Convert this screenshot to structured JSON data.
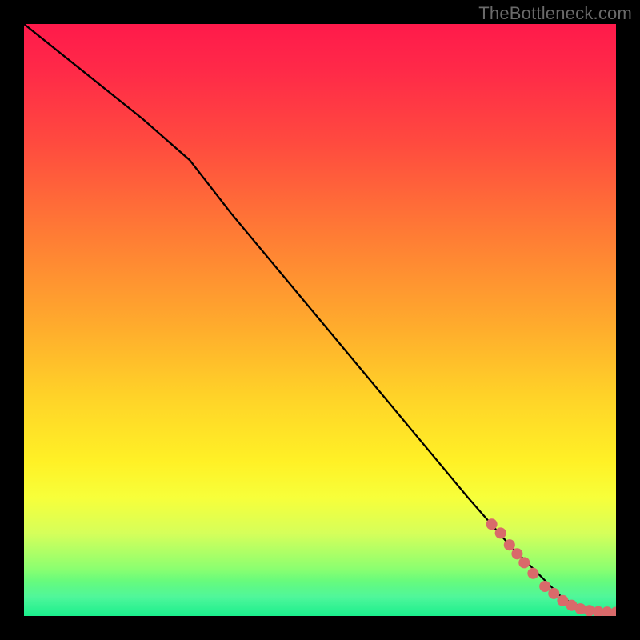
{
  "watermark": "TheBottleneck.com",
  "chart_data": {
    "type": "line",
    "title": "",
    "xlabel": "",
    "ylabel": "",
    "xlim": [
      0,
      100
    ],
    "ylim": [
      0,
      100
    ],
    "grid": false,
    "legend": false,
    "background_gradient": {
      "stops": [
        {
          "pos": 0.0,
          "color": "#ff1a4b"
        },
        {
          "pos": 0.5,
          "color": "#ffa82d"
        },
        {
          "pos": 0.75,
          "color": "#fff126"
        },
        {
          "pos": 1.0,
          "color": "#1aee8c"
        }
      ],
      "direction": "vertical"
    },
    "series": [
      {
        "name": "curve",
        "color": "#000000",
        "width": 2.2,
        "x": [
          0,
          10,
          20,
          28,
          35,
          45,
          55,
          65,
          75,
          82,
          86,
          89,
          91,
          93,
          95,
          97,
          100
        ],
        "y": [
          100,
          92,
          84,
          77,
          68,
          56,
          44,
          32,
          20,
          12,
          8,
          5,
          3,
          2,
          1.2,
          0.8,
          0.6
        ]
      }
    ],
    "markers": {
      "name": "highlighted-points",
      "color": "#d96a6a",
      "r": 7,
      "x": [
        79,
        80.5,
        82,
        83.3,
        84.5,
        86,
        88,
        89.5,
        91,
        92.5,
        94,
        95.5,
        97,
        98.5,
        100
      ],
      "y": [
        15.5,
        14,
        12,
        10.5,
        9,
        7.2,
        5,
        3.8,
        2.6,
        1.8,
        1.2,
        0.9,
        0.7,
        0.65,
        0.6
      ]
    }
  }
}
